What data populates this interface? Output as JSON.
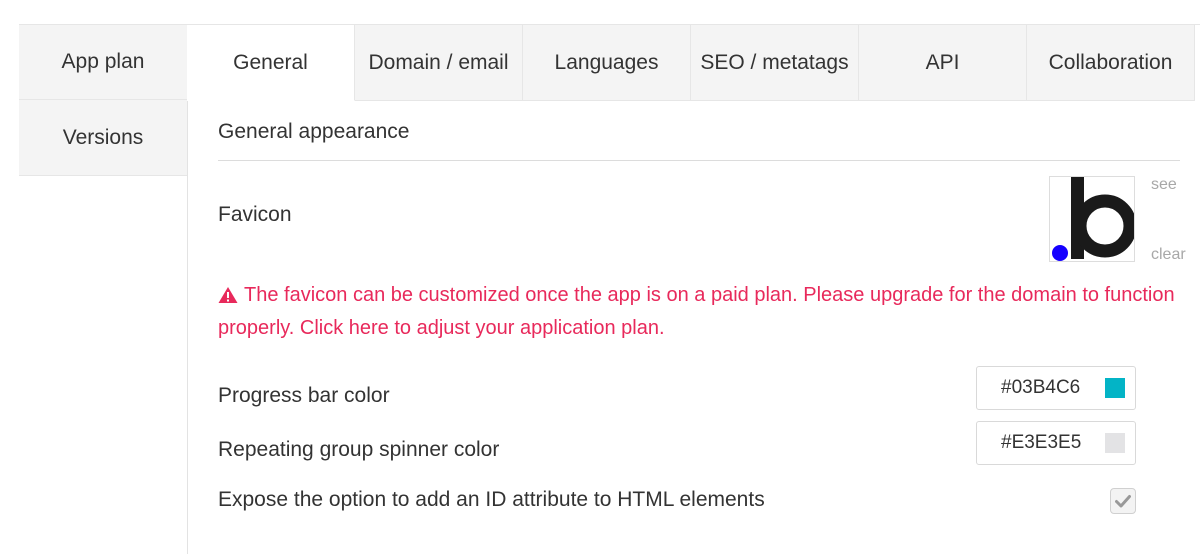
{
  "left_tabs": [
    {
      "label": "App plan"
    },
    {
      "label": "Versions"
    }
  ],
  "top_tabs": [
    {
      "label": "General",
      "active": true
    },
    {
      "label": "Domain / email"
    },
    {
      "label": "Languages"
    },
    {
      "label": "SEO / metatags"
    },
    {
      "label": "API"
    },
    {
      "label": "Collaboration"
    }
  ],
  "section": {
    "title": "General appearance"
  },
  "favicon": {
    "label": "Favicon",
    "see_link": "see",
    "clear_link": "clear",
    "icon": "bubble-b-logo-icon"
  },
  "warning": {
    "text": "The favicon can be customized once the app is on a paid plan. Please upgrade for the domain to function properly. Click here to adjust your application plan.",
    "color": "#E8295B",
    "icon": "warning-triangle-icon"
  },
  "settings": {
    "progress_bar": {
      "label": "Progress bar color",
      "value": "#03B4C6"
    },
    "spinner": {
      "label": "Repeating group spinner color",
      "value": "#E3E3E5"
    },
    "expose_id": {
      "label": "Expose the option to add an ID attribute to HTML elements",
      "checked": true
    }
  }
}
